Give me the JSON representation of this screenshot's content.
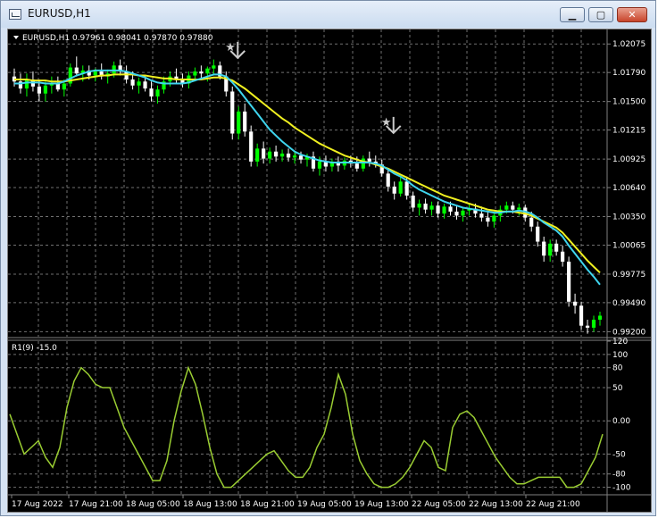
{
  "window": {
    "title": "EURUSD,H1",
    "minimize_glyph": "▁",
    "maximize_glyph": "▢",
    "close_glyph": "✕"
  },
  "main_chart": {
    "header": "EURUSD,H1  0.97961 0.98041 0.97870 0.97880",
    "price_ticks": [
      "1.02075",
      "1.01790",
      "1.01500",
      "1.01215",
      "1.00925",
      "1.00640",
      "1.00350",
      "1.00065",
      "0.99775",
      "0.99490",
      "0.99200"
    ],
    "ylim": [
      0.9915,
      1.0222
    ],
    "current_price": "0.97880",
    "colors": {
      "bull": "#00ff00",
      "bear": "#ffffff",
      "fast_ma": "#3fd5ee",
      "slow_ma": "#f0f020",
      "grid": "#707070",
      "arrow": "#cccccc"
    },
    "signal_arrows": [
      {
        "index": 35,
        "price": 1.019,
        "icon": "down-arrow-icon"
      },
      {
        "index": 60,
        "price": 1.0115,
        "icon": "down-arrow-icon"
      }
    ]
  },
  "indicator": {
    "label": "R1(9) -15.0",
    "ticks": [
      "120",
      "100",
      "80",
      "50",
      "0.00",
      "-50",
      "-80",
      "-100"
    ],
    "tick_values": [
      120,
      100,
      80,
      50,
      0,
      -50,
      -80,
      -100
    ],
    "ylim": [
      -110,
      120
    ],
    "color": "#9acd32"
  },
  "time_labels": [
    "17 Aug 2022",
    "17 Aug 21:00",
    "18 Aug 05:00",
    "18 Aug 13:00",
    "18 Aug 21:00",
    "19 Aug 05:00",
    "19 Aug 13:00",
    "22 Aug 05:00",
    "22 Aug 13:00",
    "22 Aug 21:00"
  ],
  "chart_data": {
    "type": "candlestick",
    "symbol": "EURUSD",
    "timeframe": "H1",
    "ohlc": [
      [
        1.0175,
        1.0183,
        1.0165,
        1.017
      ],
      [
        1.017,
        1.0178,
        1.0158,
        1.0163
      ],
      [
        1.0163,
        1.0178,
        1.0155,
        1.0172
      ],
      [
        1.0172,
        1.018,
        1.016,
        1.0165
      ],
      [
        1.0165,
        1.0172,
        1.015,
        1.0158
      ],
      [
        1.0158,
        1.017,
        1.015,
        1.0166
      ],
      [
        1.0166,
        1.0175,
        1.0158,
        1.0168
      ],
      [
        1.0168,
        1.0175,
        1.016,
        1.0162
      ],
      [
        1.0162,
        1.0172,
        1.0155,
        1.0168
      ],
      [
        1.0168,
        1.0188,
        1.0165,
        1.0184
      ],
      [
        1.0184,
        1.0195,
        1.0175,
        1.0178
      ],
      [
        1.0178,
        1.0186,
        1.017,
        1.0181
      ],
      [
        1.0181,
        1.0186,
        1.0172,
        1.0176
      ],
      [
        1.0176,
        1.0183,
        1.017,
        1.018
      ],
      [
        1.018,
        1.0188,
        1.0172,
        1.0175
      ],
      [
        1.0175,
        1.0182,
        1.0168,
        1.0178
      ],
      [
        1.0178,
        1.019,
        1.0174,
        1.0186
      ],
      [
        1.0186,
        1.0192,
        1.0176,
        1.018
      ],
      [
        1.018,
        1.0186,
        1.0168,
        1.0172
      ],
      [
        1.0172,
        1.018,
        1.0162,
        1.0166
      ],
      [
        1.0166,
        1.0174,
        1.0158,
        1.017
      ],
      [
        1.017,
        1.0176,
        1.016,
        1.0163
      ],
      [
        1.0163,
        1.017,
        1.015,
        1.0155
      ],
      [
        1.0155,
        1.0166,
        1.0148,
        1.0162
      ],
      [
        1.0162,
        1.0175,
        1.0158,
        1.017
      ],
      [
        1.017,
        1.018,
        1.0165,
        1.0175
      ],
      [
        1.0175,
        1.0183,
        1.0168,
        1.0172
      ],
      [
        1.0172,
        1.0178,
        1.0164,
        1.0168
      ],
      [
        1.0168,
        1.018,
        1.0163,
        1.0176
      ],
      [
        1.0176,
        1.0184,
        1.017,
        1.018
      ],
      [
        1.018,
        1.0186,
        1.0172,
        1.0178
      ],
      [
        1.0178,
        1.0185,
        1.017,
        1.0183
      ],
      [
        1.0183,
        1.0192,
        1.0176,
        1.0186
      ],
      [
        1.0186,
        1.019,
        1.0172,
        1.0175
      ],
      [
        1.0175,
        1.018,
        1.0155,
        1.016
      ],
      [
        1.016,
        1.0165,
        1.0112,
        1.0118
      ],
      [
        1.0118,
        1.0145,
        1.0112,
        1.014
      ],
      [
        1.014,
        1.0148,
        1.0115,
        1.012
      ],
      [
        1.012,
        1.0126,
        1.0085,
        1.009
      ],
      [
        1.009,
        1.0108,
        1.0085,
        1.0103
      ],
      [
        1.0103,
        1.011,
        1.0088,
        1.0093
      ],
      [
        1.0093,
        1.0104,
        1.0088,
        1.01
      ],
      [
        1.01,
        1.0106,
        1.009,
        1.0095
      ],
      [
        1.0095,
        1.0102,
        1.009,
        1.0098
      ],
      [
        1.0098,
        1.0103,
        1.009,
        1.0094
      ],
      [
        1.0094,
        1.01,
        1.0088,
        1.0096
      ],
      [
        1.0096,
        1.01,
        1.0088,
        1.0092
      ],
      [
        1.0092,
        1.0098,
        1.0085,
        1.0095
      ],
      [
        1.0095,
        1.01,
        1.008,
        1.0083
      ],
      [
        1.0083,
        1.0095,
        1.0076,
        1.009
      ],
      [
        1.009,
        1.0096,
        1.008,
        1.0085
      ],
      [
        1.0085,
        1.0093,
        1.008,
        1.009
      ],
      [
        1.009,
        1.0095,
        1.008,
        1.0086
      ],
      [
        1.0086,
        1.0094,
        1.0082,
        1.0091
      ],
      [
        1.0091,
        1.0096,
        1.0084,
        1.0088
      ],
      [
        1.0088,
        1.0095,
        1.008,
        1.0083
      ],
      [
        1.0083,
        1.0096,
        1.008,
        1.0093
      ],
      [
        1.0093,
        1.01,
        1.0085,
        1.009
      ],
      [
        1.009,
        1.0096,
        1.0084,
        1.0087
      ],
      [
        1.0087,
        1.0092,
        1.0075,
        1.0078
      ],
      [
        1.0078,
        1.0082,
        1.006,
        1.0065
      ],
      [
        1.0065,
        1.007,
        1.0052,
        1.0058
      ],
      [
        1.0058,
        1.0075,
        1.0055,
        1.007
      ],
      [
        1.007,
        1.0075,
        1.0052,
        1.0056
      ],
      [
        1.0056,
        1.006,
        1.004,
        1.0044
      ],
      [
        1.0044,
        1.0052,
        1.0036,
        1.0048
      ],
      [
        1.0048,
        1.0053,
        1.0038,
        1.0042
      ],
      [
        1.0042,
        1.005,
        1.0036,
        1.0046
      ],
      [
        1.0046,
        1.005,
        1.0034,
        1.0038
      ],
      [
        1.0038,
        1.0048,
        1.0033,
        1.0045
      ],
      [
        1.0045,
        1.005,
        1.0036,
        1.004
      ],
      [
        1.004,
        1.0046,
        1.0032,
        1.0036
      ],
      [
        1.0036,
        1.0044,
        1.003,
        1.0041
      ],
      [
        1.0041,
        1.0048,
        1.0036,
        1.0043
      ],
      [
        1.0043,
        1.0048,
        1.0034,
        1.0038
      ],
      [
        1.0038,
        1.0045,
        1.003,
        1.0034
      ],
      [
        1.0034,
        1.004,
        1.0025,
        1.003
      ],
      [
        1.003,
        1.004,
        1.0024,
        1.0036
      ],
      [
        1.0036,
        1.0046,
        1.003,
        1.0042
      ],
      [
        1.0042,
        1.005,
        1.0038,
        1.0046
      ],
      [
        1.0046,
        1.005,
        1.0038,
        1.0042
      ],
      [
        1.0042,
        1.0048,
        1.0036,
        1.0044
      ],
      [
        1.0044,
        1.0047,
        1.003,
        1.0034
      ],
      [
        1.0034,
        1.004,
        1.002,
        1.0025
      ],
      [
        1.0025,
        1.003,
        1.0005,
        1.001
      ],
      [
        1.001,
        1.0015,
        0.999,
        0.9996
      ],
      [
        0.9996,
        1.0012,
        0.999,
        1.0008
      ],
      [
        1.0008,
        1.0012,
        0.9996,
        1.0
      ],
      [
        1.0,
        1.0006,
        0.9985,
        0.999
      ],
      [
        0.999,
        0.9995,
        0.9945,
        0.995
      ],
      [
        0.995,
        0.9958,
        0.9938,
        0.9946
      ],
      [
        0.9946,
        0.995,
        0.9922,
        0.9926
      ],
      [
        0.9926,
        0.9932,
        0.9918,
        0.9924
      ],
      [
        0.9924,
        0.9936,
        0.992,
        0.9932
      ],
      [
        0.9932,
        0.994,
        0.9926,
        0.9936
      ]
    ],
    "ma_fast": [
      1.0168,
      1.0168,
      1.0169,
      1.0169,
      1.0169,
      1.0168,
      1.0168,
      1.0168,
      1.017,
      1.0173,
      1.0176,
      1.0178,
      1.018,
      1.0181,
      1.0181,
      1.0181,
      1.0181,
      1.0181,
      1.018,
      1.0178,
      1.0176,
      1.0174,
      1.0171,
      1.0169,
      1.0168,
      1.0168,
      1.0168,
      1.0168,
      1.0169,
      1.0171,
      1.0173,
      1.0175,
      1.0177,
      1.0177,
      1.0175,
      1.0169,
      1.0162,
      1.0154,
      1.0146,
      1.0138,
      1.013,
      1.0122,
      1.0116,
      1.011,
      1.0105,
      1.01,
      1.0097,
      1.0095,
      1.0093,
      1.0091,
      1.009,
      1.0089,
      1.0089,
      1.0089,
      1.0089,
      1.0089,
      1.0089,
      1.0089,
      1.0088,
      1.0086,
      1.0082,
      1.0078,
      1.0075,
      1.0071,
      1.0066,
      1.0062,
      1.0059,
      1.0056,
      1.0053,
      1.005,
      1.0048,
      1.0046,
      1.0044,
      1.0043,
      1.0042,
      1.0041,
      1.004,
      1.0039,
      1.0039,
      1.004,
      1.004,
      1.0041,
      1.004,
      1.0038,
      1.0034,
      1.0029,
      1.0025,
      1.0021,
      1.0015,
      1.0006,
      0.9998,
      0.999,
      0.9982,
      0.9975,
      0.9967
    ],
    "ma_slow": [
      1.0172,
      1.0172,
      1.0172,
      1.0171,
      1.0171,
      1.0171,
      1.017,
      1.017,
      1.017,
      1.0171,
      1.0172,
      1.0173,
      1.0174,
      1.0175,
      1.0176,
      1.0176,
      1.0177,
      1.0177,
      1.0177,
      1.0177,
      1.0176,
      1.0176,
      1.0175,
      1.0174,
      1.0173,
      1.0173,
      1.0172,
      1.0172,
      1.0172,
      1.0172,
      1.0172,
      1.0173,
      1.0174,
      1.0174,
      1.0173,
      1.0171,
      1.0167,
      1.0163,
      1.0158,
      1.0153,
      1.0148,
      1.0143,
      1.0138,
      1.0133,
      1.0129,
      1.0124,
      1.012,
      1.0116,
      1.0112,
      1.0108,
      1.0105,
      1.0102,
      1.0099,
      1.0096,
      1.0094,
      1.0092,
      1.009,
      1.0089,
      1.0087,
      1.0085,
      1.0083,
      1.008,
      1.0077,
      1.0074,
      1.0071,
      1.0068,
      1.0065,
      1.0062,
      1.0059,
      1.0056,
      1.0054,
      1.0052,
      1.005,
      1.0048,
      1.0046,
      1.0044,
      1.0042,
      1.0041,
      1.004,
      1.004,
      1.004,
      1.0039,
      1.0038,
      1.0036,
      1.0033,
      1.003,
      1.0027,
      1.0024,
      1.0019,
      1.0012,
      1.0005,
      0.9998,
      0.9991,
      0.9985,
      0.9979
    ],
    "indicator_values": [
      10,
      -20,
      -50,
      -40,
      -30,
      -55,
      -70,
      -40,
      20,
      60,
      80,
      70,
      55,
      50,
      50,
      20,
      -10,
      -30,
      -50,
      -70,
      -90,
      -90,
      -60,
      0,
      45,
      80,
      55,
      10,
      -40,
      -80,
      -100,
      -100,
      -90,
      -80,
      -70,
      -60,
      -50,
      -45,
      -60,
      -75,
      -85,
      -85,
      -70,
      -40,
      -20,
      20,
      70,
      40,
      -20,
      -60,
      -80,
      -95,
      -100,
      -100,
      -95,
      -85,
      -70,
      -50,
      -30,
      -40,
      -70,
      -75,
      -10,
      10,
      15,
      5,
      -15,
      -35,
      -55,
      -70,
      -85,
      -95,
      -95,
      -90,
      -85,
      -85,
      -85,
      -85,
      -100,
      -100,
      -95,
      -75,
      -55,
      -20
    ]
  }
}
